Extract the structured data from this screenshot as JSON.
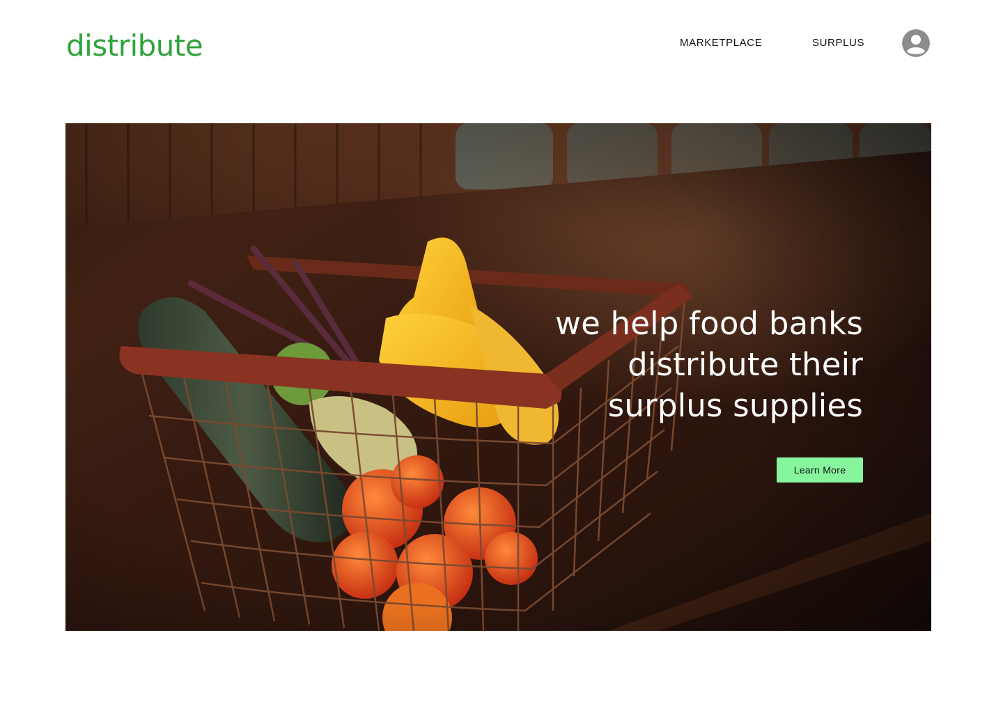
{
  "header": {
    "logo": "distribute",
    "nav": {
      "marketplace": "MARKETPLACE",
      "surplus": "SURPLUS"
    },
    "account_icon": "user-circle-icon"
  },
  "hero": {
    "headline_lines": [
      "we help food banks",
      "distribute their",
      "surplus supplies"
    ],
    "cta_label": "Learn More",
    "image_subject": "wire basket of vegetables on wooden counter"
  },
  "colors": {
    "brand_green": "#2fa43c",
    "cta_green": "#86f59e",
    "icon_gray": "#8c8c8c"
  }
}
